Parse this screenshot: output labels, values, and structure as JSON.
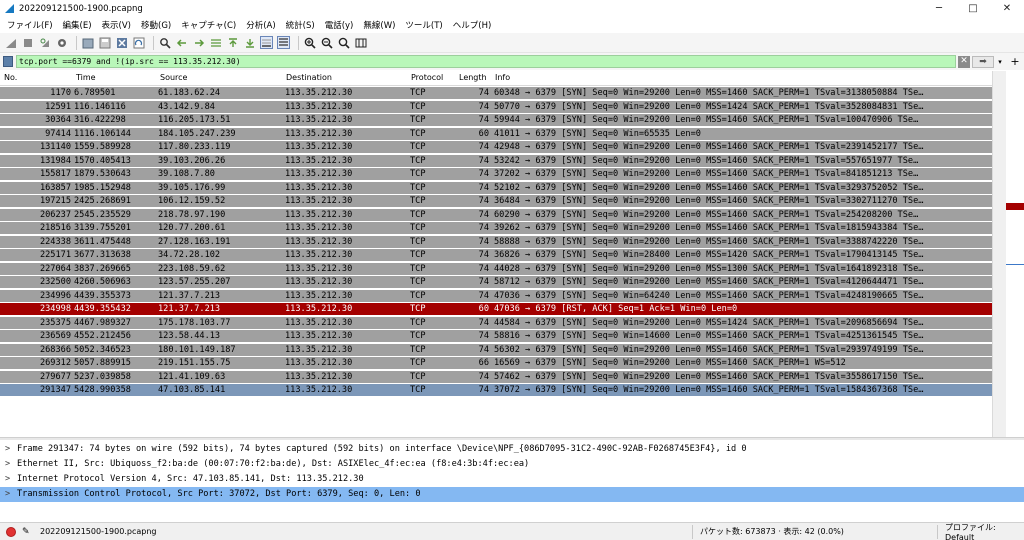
{
  "window": {
    "title": "202209121500-1900.pcapng",
    "minimize": "─",
    "maximize": "□",
    "close": "✕"
  },
  "menu": [
    "ファイル(F)",
    "編集(E)",
    "表示(V)",
    "移動(G)",
    "キャプチャ(C)",
    "分析(A)",
    "統計(S)",
    "電話(y)",
    "無線(W)",
    "ツール(T)",
    "ヘルプ(H)"
  ],
  "toolbar_icons": [
    "shark-fin-start-icon",
    "stop-icon",
    "restart-icon",
    "options-gear-icon",
    "open-file-icon",
    "save-file-icon",
    "close-file-icon",
    "reload-icon",
    "find-icon",
    "go-back-icon",
    "go-forward-icon",
    "go-to-packet-icon",
    "first-packet-icon",
    "last-packet-icon",
    "autoscroll-icon",
    "colorize-icon",
    "zoom-in-icon",
    "zoom-out-icon",
    "zoom-normal-icon",
    "resize-columns-icon"
  ],
  "filter": {
    "value": "tcp.port ==6379 and !(ip.src == 113.35.212.30)",
    "clear": "✕",
    "apply": "➡",
    "dropdown": "▾",
    "add": "+"
  },
  "columns": {
    "no": "No.",
    "time": "Time",
    "source": "Source",
    "destination": "Destination",
    "protocol": "Protocol",
    "length": "Length",
    "info": "Info"
  },
  "packets": [
    {
      "no": "1170",
      "time": "6.789501",
      "src": "61.183.62.24",
      "dst": "113.35.212.30",
      "proto": "TCP",
      "len": "74",
      "info": "60348 → 6379 [SYN] Seq=0 Win=29200 Len=0 MSS=1460 SACK_PERM=1 TSval=3138050884 TSe…",
      "style": "normal"
    },
    {
      "no": "12591",
      "time": "116.146116",
      "src": "43.142.9.84",
      "dst": "113.35.212.30",
      "proto": "TCP",
      "len": "74",
      "info": "50770 → 6379 [SYN] Seq=0 Win=29200 Len=0 MSS=1424 SACK_PERM=1 TSval=3528084831 TSe…",
      "style": "normal"
    },
    {
      "no": "30364",
      "time": "316.422298",
      "src": "116.205.173.51",
      "dst": "113.35.212.30",
      "proto": "TCP",
      "len": "74",
      "info": "59944 → 6379 [SYN] Seq=0 Win=29200 Len=0 MSS=1460 SACK_PERM=1 TSval=100470906 TSe…",
      "style": "normal"
    },
    {
      "no": "97414",
      "time": "1116.106144",
      "src": "184.105.247.239",
      "dst": "113.35.212.30",
      "proto": "TCP",
      "len": "60",
      "info": "41011 → 6379 [SYN] Seq=0 Win=65535 Len=0",
      "style": "normal"
    },
    {
      "no": "131140",
      "time": "1559.589928",
      "src": "117.80.233.119",
      "dst": "113.35.212.30",
      "proto": "TCP",
      "len": "74",
      "info": "42948 → 6379 [SYN] Seq=0 Win=29200 Len=0 MSS=1460 SACK_PERM=1 TSval=2391452177 TSe…",
      "style": "normal"
    },
    {
      "no": "131984",
      "time": "1570.405413",
      "src": "39.103.206.26",
      "dst": "113.35.212.30",
      "proto": "TCP",
      "len": "74",
      "info": "53242 → 6379 [SYN] Seq=0 Win=29200 Len=0 MSS=1460 SACK_PERM=1 TSval=557651977 TSe…",
      "style": "normal"
    },
    {
      "no": "155817",
      "time": "1879.530643",
      "src": "39.108.7.80",
      "dst": "113.35.212.30",
      "proto": "TCP",
      "len": "74",
      "info": "37202 → 6379 [SYN] Seq=0 Win=29200 Len=0 MSS=1460 SACK_PERM=1 TSval=841851213 TSe…",
      "style": "normal"
    },
    {
      "no": "163857",
      "time": "1985.152948",
      "src": "39.105.176.99",
      "dst": "113.35.212.30",
      "proto": "TCP",
      "len": "74",
      "info": "52102 → 6379 [SYN] Seq=0 Win=29200 Len=0 MSS=1460 SACK_PERM=1 TSval=3293752052 TSe…",
      "style": "normal"
    },
    {
      "no": "197215",
      "time": "2425.268691",
      "src": "106.12.159.52",
      "dst": "113.35.212.30",
      "proto": "TCP",
      "len": "74",
      "info": "36484 → 6379 [SYN] Seq=0 Win=29200 Len=0 MSS=1460 SACK_PERM=1 TSval=3302711270 TSe…",
      "style": "normal"
    },
    {
      "no": "206237",
      "time": "2545.235529",
      "src": "218.78.97.190",
      "dst": "113.35.212.30",
      "proto": "TCP",
      "len": "74",
      "info": "60290 → 6379 [SYN] Seq=0 Win=29200 Len=0 MSS=1460 SACK_PERM=1 TSval=254208200 TSe…",
      "style": "normal"
    },
    {
      "no": "218516",
      "time": "3139.755201",
      "src": "120.77.200.61",
      "dst": "113.35.212.30",
      "proto": "TCP",
      "len": "74",
      "info": "39262 → 6379 [SYN] Seq=0 Win=29200 Len=0 MSS=1460 SACK_PERM=1 TSval=1815943384 TSe…",
      "style": "normal"
    },
    {
      "no": "224338",
      "time": "3611.475448",
      "src": "27.128.163.191",
      "dst": "113.35.212.30",
      "proto": "TCP",
      "len": "74",
      "info": "58888 → 6379 [SYN] Seq=0 Win=29200 Len=0 MSS=1460 SACK_PERM=1 TSval=3388742220 TSe…",
      "style": "normal"
    },
    {
      "no": "225171",
      "time": "3677.313638",
      "src": "34.72.28.102",
      "dst": "113.35.212.30",
      "proto": "TCP",
      "len": "74",
      "info": "36826 → 6379 [SYN] Seq=0 Win=28400 Len=0 MSS=1420 SACK_PERM=1 TSval=1790413145 TSe…",
      "style": "normal"
    },
    {
      "no": "227064",
      "time": "3837.269665",
      "src": "223.108.59.62",
      "dst": "113.35.212.30",
      "proto": "TCP",
      "len": "74",
      "info": "44028 → 6379 [SYN] Seq=0 Win=29200 Len=0 MSS=1300 SACK_PERM=1 TSval=1641892318 TSe…",
      "style": "normal"
    },
    {
      "no": "232500",
      "time": "4260.506963",
      "src": "123.57.255.207",
      "dst": "113.35.212.30",
      "proto": "TCP",
      "len": "74",
      "info": "58712 → 6379 [SYN] Seq=0 Win=29200 Len=0 MSS=1460 SACK_PERM=1 TSval=4120644471 TSe…",
      "style": "normal"
    },
    {
      "no": "234996",
      "time": "4439.355373",
      "src": "121.37.7.213",
      "dst": "113.35.212.30",
      "proto": "TCP",
      "len": "74",
      "info": "47036 → 6379 [SYN] Seq=0 Win=64240 Len=0 MSS=1460 SACK_PERM=1 TSval=4248190665 TSe…",
      "style": "normal"
    },
    {
      "no": "234998",
      "time": "4439.355432",
      "src": "121.37.7.213",
      "dst": "113.35.212.30",
      "proto": "TCP",
      "len": "60",
      "info": "47036 → 6379 [RST, ACK] Seq=1 Ack=1 Win=0 Len=0",
      "style": "rst"
    },
    {
      "no": "235375",
      "time": "4467.989327",
      "src": "175.178.103.77",
      "dst": "113.35.212.30",
      "proto": "TCP",
      "len": "74",
      "info": "44584 → 6379 [SYN] Seq=0 Win=29200 Len=0 MSS=1424 SACK_PERM=1 TSval=2096856694 TSe…",
      "style": "normal"
    },
    {
      "no": "236569",
      "time": "4552.212456",
      "src": "123.58.44.13",
      "dst": "113.35.212.30",
      "proto": "TCP",
      "len": "74",
      "info": "58816 → 6379 [SYN] Seq=0 Win=14600 Len=0 MSS=1460 SACK_PERM=1 TSval=4251361545 TSe…",
      "style": "normal"
    },
    {
      "no": "268366",
      "time": "5052.346523",
      "src": "180.101.149.187",
      "dst": "113.35.212.30",
      "proto": "TCP",
      "len": "74",
      "info": "56302 → 6379 [SYN] Seq=0 Win=29200 Len=0 MSS=1460 SACK_PERM=1 TSval=2939749199 TSe…",
      "style": "normal"
    },
    {
      "no": "269312",
      "time": "5057.889915",
      "src": "219.151.155.75",
      "dst": "113.35.212.30",
      "proto": "TCP",
      "len": "66",
      "info": "16569 → 6379 [SYN] Seq=0 Win=29200 Len=0 MSS=1460 SACK_PERM=1 WS=512",
      "style": "normal"
    },
    {
      "no": "279677",
      "time": "5237.039858",
      "src": "121.41.109.63",
      "dst": "113.35.212.30",
      "proto": "TCP",
      "len": "74",
      "info": "57462 → 6379 [SYN] Seq=0 Win=29200 Len=0 MSS=1460 SACK_PERM=1 TSval=3558617150 TSe…",
      "style": "normal"
    },
    {
      "no": "291347",
      "time": "5428.990358",
      "src": "47.103.85.141",
      "dst": "113.35.212.30",
      "proto": "TCP",
      "len": "74",
      "info": "37072 → 6379 [SYN] Seq=0 Win=29200 Len=0 MSS=1460 SACK_PERM=1 TSval=1584367368 TSe…",
      "style": "selected"
    }
  ],
  "details": [
    {
      "arrow": ">",
      "text": "Frame 291347: 74 bytes on wire (592 bits), 74 bytes captured (592 bits) on interface \\Device\\NPF_{086D7095-31C2-490C-92AB-F0268745E3F4}, id 0",
      "highlight": false
    },
    {
      "arrow": ">",
      "text": "Ethernet II, Src: Ubiquoss_f2:ba:de (00:07:70:f2:ba:de), Dst: ASIXElec_4f:ec:ea (f8:e4:3b:4f:ec:ea)",
      "highlight": false
    },
    {
      "arrow": ">",
      "text": "Internet Protocol Version 4, Src: 47.103.85.141, Dst: 113.35.212.30",
      "highlight": false
    },
    {
      "arrow": ">",
      "text": "Transmission Control Protocol, Src Port: 37072, Dst Port: 6379, Seq: 0, Len: 0",
      "highlight": true
    }
  ],
  "status": {
    "file": "202209121500-1900.pcapng",
    "stats": "パケット数: 673873 · 表示: 42 (0.0%)",
    "profile": "プロファイル: Default"
  },
  "colors": {
    "row_normal": "#a0a0a0",
    "row_rst": "#a40000",
    "row_selected": "#7c97b8",
    "filter_ok": "#b9f7b9",
    "detail_highlight": "#84b8f2"
  }
}
